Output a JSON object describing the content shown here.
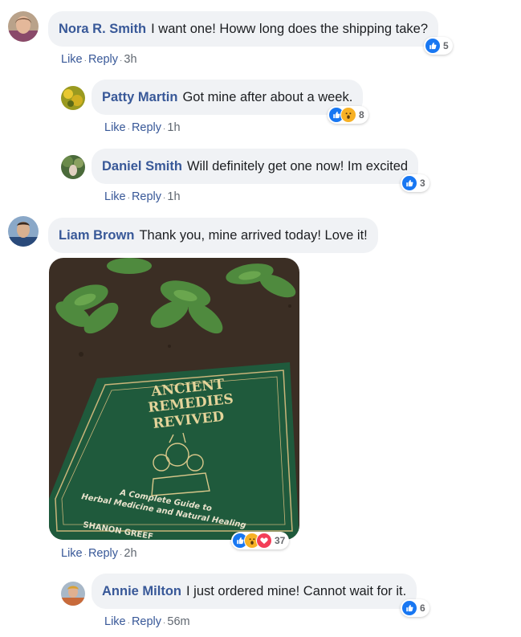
{
  "comments": [
    {
      "author": "Nora R. Smith",
      "text": "I want one! Howw long does the shipping take?",
      "like": "Like",
      "reply": "Reply",
      "time": "3h",
      "reaction_count": "5"
    },
    {
      "author": "Patty Martin",
      "text": "Got mine after about a week.",
      "like": "Like",
      "reply": "Reply",
      "time": "1h",
      "reaction_count": "8"
    },
    {
      "author": "Daniel Smith",
      "text": "Will definitely get one now! Im excited",
      "like": "Like",
      "reply": "Reply",
      "time": "1h",
      "reaction_count": "3"
    },
    {
      "author": "Liam Brown",
      "text": "Thank you, mine arrived today! Love it!",
      "like": "Like",
      "reply": "Reply",
      "time": "2h",
      "reaction_count": "37"
    },
    {
      "author": "Annie Milton",
      "text": "I just ordered mine! Cannot wait for it.",
      "like": "Like",
      "reply": "Reply",
      "time": "56m",
      "reaction_count": "6"
    }
  ],
  "photo_book": {
    "title_line1": "ANCIENT",
    "title_line2": "REMEDIES",
    "title_line3": "REVIVED",
    "subtitle_line1": "A Complete Guide to",
    "subtitle_line2": "Herbal Medicine and Natural Healing",
    "author": "SHANON GREEF"
  },
  "reaction_icons": [
    "like-icon",
    "wow-icon",
    "love-icon"
  ],
  "colors": {
    "link": "#385898",
    "bubble": "#f0f2f5",
    "like": "#1877f2",
    "wow": "#f7b125",
    "love": "#f33e58",
    "book_green": "#1f5a3c"
  }
}
